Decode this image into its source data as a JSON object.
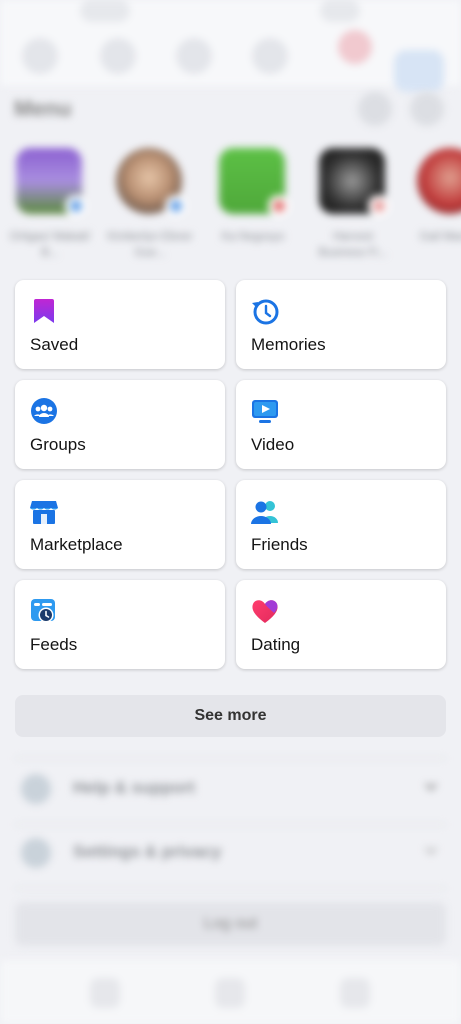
{
  "header": {
    "title": "Menu"
  },
  "shortcuts": [
    {
      "name": "Ortigas/ Makati/ B..."
    },
    {
      "name": "Kimberlyn Ebner Gue..."
    },
    {
      "name": "Ka Negosyo"
    },
    {
      "name": "Harvest Business Fi..."
    },
    {
      "name": "Gail Maraf..."
    }
  ],
  "cards": {
    "saved": {
      "label": "Saved",
      "icon": "bookmark-icon"
    },
    "memories": {
      "label": "Memories",
      "icon": "clock-history-icon"
    },
    "groups": {
      "label": "Groups",
      "icon": "groups-icon"
    },
    "video": {
      "label": "Video",
      "icon": "video-play-icon"
    },
    "marketplace": {
      "label": "Marketplace",
      "icon": "storefront-icon"
    },
    "friends": {
      "label": "Friends",
      "icon": "friends-icon"
    },
    "feeds": {
      "label": "Feeds",
      "icon": "feeds-clock-icon"
    },
    "dating": {
      "label": "Dating",
      "icon": "heart-icon"
    }
  },
  "see_more": {
    "label": "See more"
  },
  "accordions": [
    {
      "label": "Help & support"
    },
    {
      "label": "Settings & privacy"
    }
  ],
  "logout": {
    "label": "Log out"
  },
  "colors": {
    "accent": "#1877f2",
    "saved": "#c22fe0",
    "dating": "#e8345a"
  }
}
